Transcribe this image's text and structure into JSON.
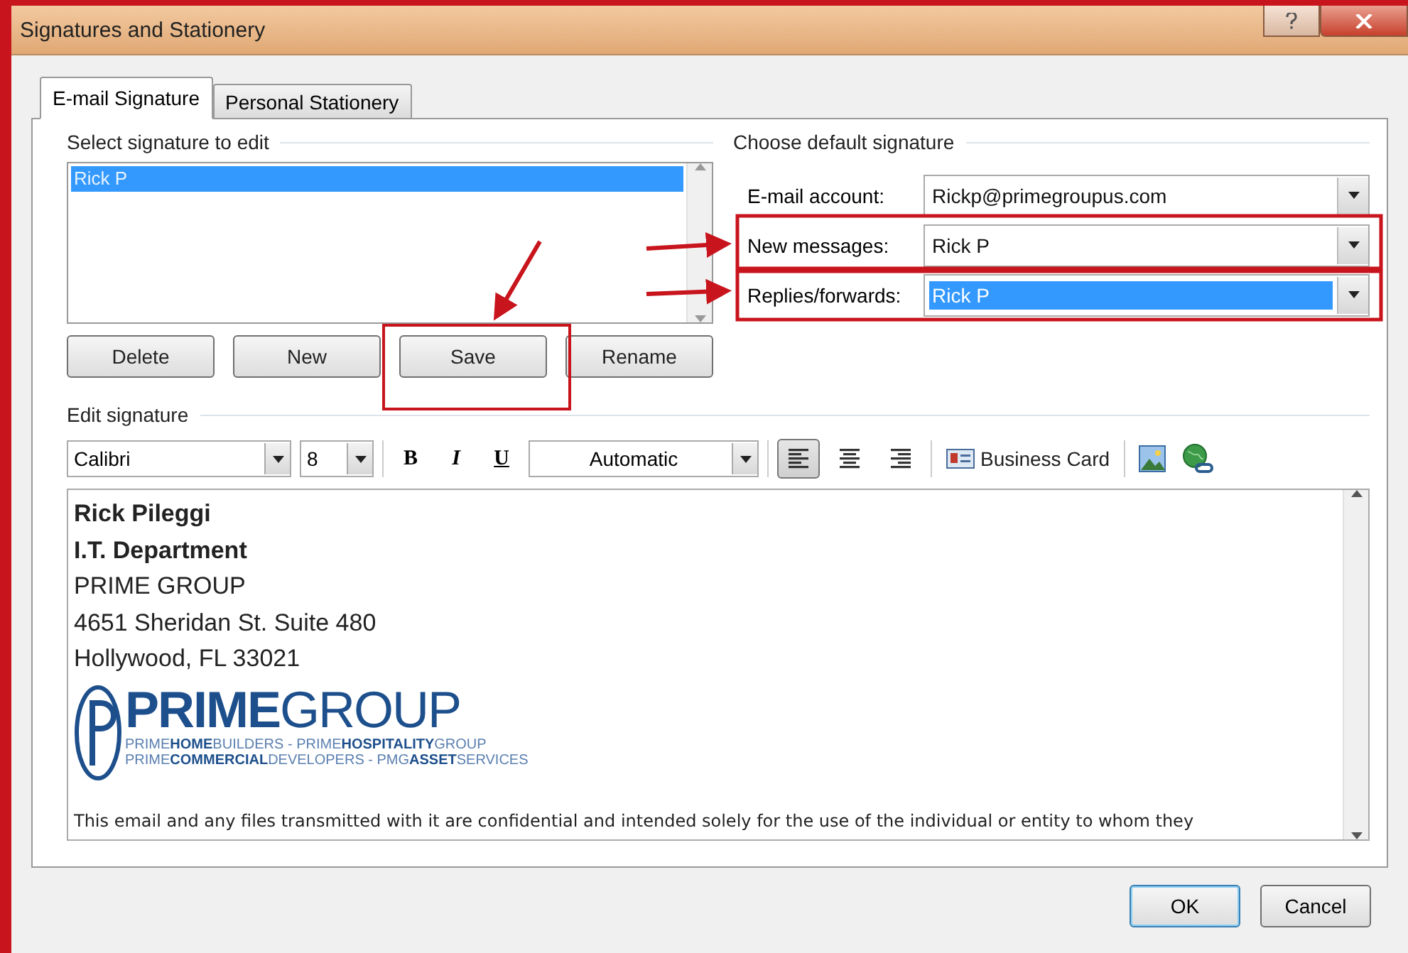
{
  "window": {
    "title": "Signatures and Stationery"
  },
  "tabs": [
    {
      "label": "E-mail Signature",
      "selected": true
    },
    {
      "label": "Personal Stationery",
      "selected": false
    }
  ],
  "select_signature": {
    "label": "Select signature to edit",
    "items": [
      {
        "label": "Rick P",
        "selected": true
      }
    ],
    "buttons": [
      "Delete",
      "New",
      "Save",
      "Rename"
    ]
  },
  "default_signature": {
    "label": "Choose default signature",
    "fields": [
      {
        "label": "E-mail account:",
        "value": "Rickp@primegroupus.com",
        "selected": false
      },
      {
        "label": "New messages:",
        "value": "Rick P",
        "selected": false
      },
      {
        "label": "Replies/forwards:",
        "value": "Rick P",
        "selected": true
      }
    ]
  },
  "edit_signature": {
    "label": "Edit signature",
    "font": "Calibri",
    "size": "8",
    "bold": "B",
    "italic": "I",
    "underline": "U",
    "color_setting": "Automatic",
    "align": [
      {
        "kind": "left",
        "selected": true
      },
      {
        "kind": "center",
        "selected": false
      },
      {
        "kind": "right",
        "selected": false
      }
    ],
    "business_card": "Business Card",
    "lines": [
      {
        "text": "Rick Pileggi",
        "bold": true
      },
      {
        "text": "I.T. Department",
        "bold": true
      },
      {
        "text": "PRIME GROUP",
        "bold": false
      },
      {
        "text": "4651 Sheridan St. Suite 480",
        "bold": false
      },
      {
        "text": "Hollywood, FL 33021",
        "bold": false
      }
    ],
    "logo": {
      "strong": "PRIME",
      "light": "GROUP",
      "taglines": [
        "PRIME**HOME**BUILDERS - PRIME**HOSPITALITY**GROUP",
        "PRIME**COMMERCIAL**DEVELOPERS - PMG**ASSET**SERVICES"
      ]
    },
    "disclaimer": "This email and any files transmitted with it are confidential and intended solely for the use of the individual or entity to whom they"
  },
  "buttons": [
    "OK",
    "Cancel"
  ]
}
